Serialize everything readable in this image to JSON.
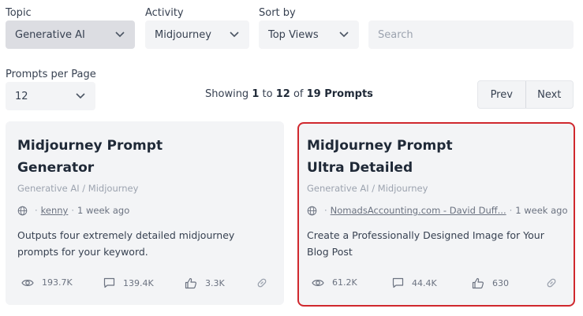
{
  "filters": {
    "topic": {
      "label": "Topic",
      "value": "Generative AI"
    },
    "activity": {
      "label": "Activity",
      "value": "Midjourney"
    },
    "sort": {
      "label": "Sort by",
      "value": "Top Views"
    },
    "search": {
      "placeholder": "Search"
    },
    "per_page": {
      "label": "Prompts per Page",
      "value": "12"
    }
  },
  "showing": {
    "prefix": "Showing",
    "from": "1",
    "to_word": "to",
    "to": "12",
    "of_word": "of",
    "total": "19 Prompts"
  },
  "pager": {
    "prev": "Prev",
    "next": "Next"
  },
  "cards": [
    {
      "title_line1": "Midjourney Prompt",
      "title_line2": "Generator",
      "category": "Generative AI / Midjourney",
      "author": "kenny",
      "time": "1 week ago",
      "desc_line1": "Outputs four extremely detailed midjourney",
      "desc_line2": "prompts for your keyword.",
      "views": "193.7K",
      "comments": "139.4K",
      "likes": "3.3K"
    },
    {
      "title_line1": "MidJourney Prompt",
      "title_line2": "Ultra Detailed",
      "category": "Generative AI / Midjourney",
      "author": "NomadsAccounting.com - David Duff...",
      "time": "1 week ago",
      "desc_line1": "Create a Professionally Designed Image for Your",
      "desc_line2": "Blog Post",
      "views": "61.2K",
      "comments": "44.4K",
      "likes": "630"
    }
  ],
  "icons": {
    "chevron": "chevron-down-icon",
    "globe": "globe-icon",
    "eye": "eye-icon",
    "comment": "comment-icon",
    "like": "thumbs-up-icon",
    "link": "link-icon"
  },
  "colors": {
    "highlight": "#d0282e",
    "card_bg": "#f3f4f6",
    "active_select": "#dcdde2"
  }
}
